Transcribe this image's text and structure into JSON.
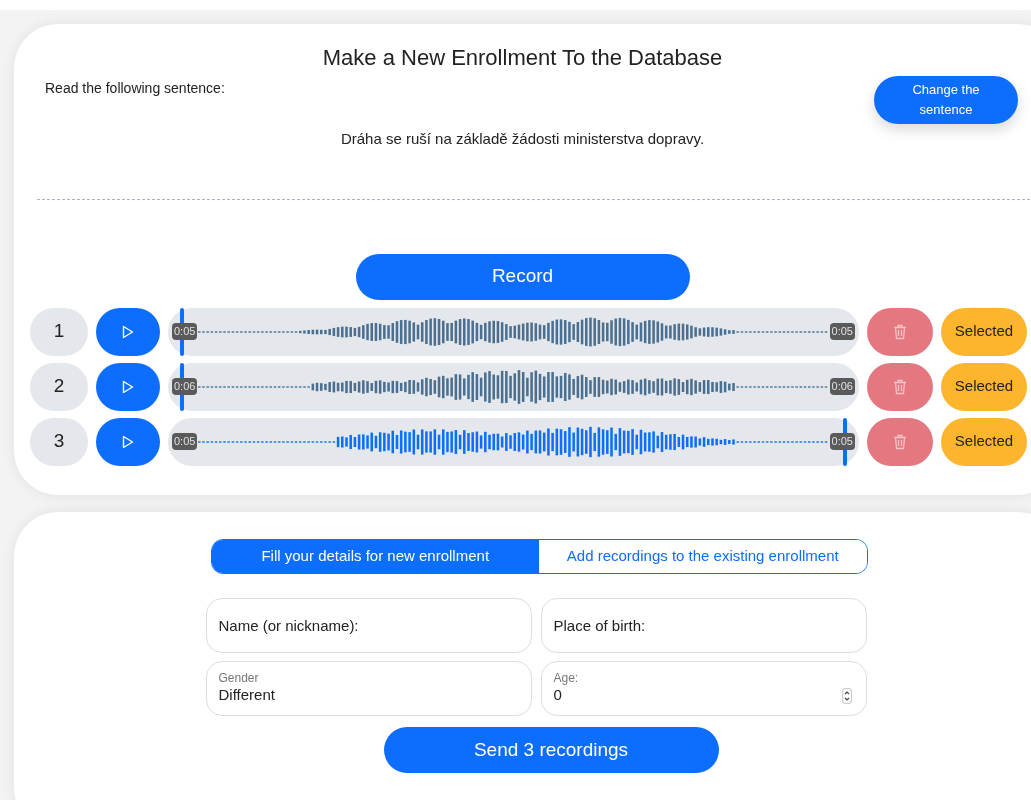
{
  "enroll_card": {
    "title": "Make a New Enrollment To the Database",
    "prompt": "Read the following sentence:",
    "change_button": "Change the sentence",
    "sentence": "Dráha se ruší na základě žádosti ministerstva dopravy.",
    "record_button": "Record",
    "recordings": [
      {
        "number": "1",
        "start_time": "0:05",
        "end_time": "0:05",
        "level": 0,
        "selected_label": "Selected"
      },
      {
        "number": "2",
        "start_time": "0:06",
        "end_time": "0:06",
        "level": 0,
        "selected_label": "Selected"
      },
      {
        "number": "3",
        "start_time": "0:05",
        "end_time": "0:05",
        "level": 1,
        "selected_label": "Selected"
      }
    ]
  },
  "details_card": {
    "tabs": [
      {
        "label": "Fill your details for new enrollment",
        "selected": true
      },
      {
        "label": "Add recordings to the existing enrollment",
        "selected": false
      }
    ],
    "fields": [
      {
        "kind": "text",
        "placeholder": "Name (or nickname):"
      },
      {
        "kind": "text",
        "placeholder": "Place of birth:"
      },
      {
        "kind": "select",
        "label": "Gender",
        "value": "Different"
      },
      {
        "kind": "number",
        "label": "Age:",
        "value": "0"
      }
    ],
    "send_button": "Send 3 recordings"
  }
}
